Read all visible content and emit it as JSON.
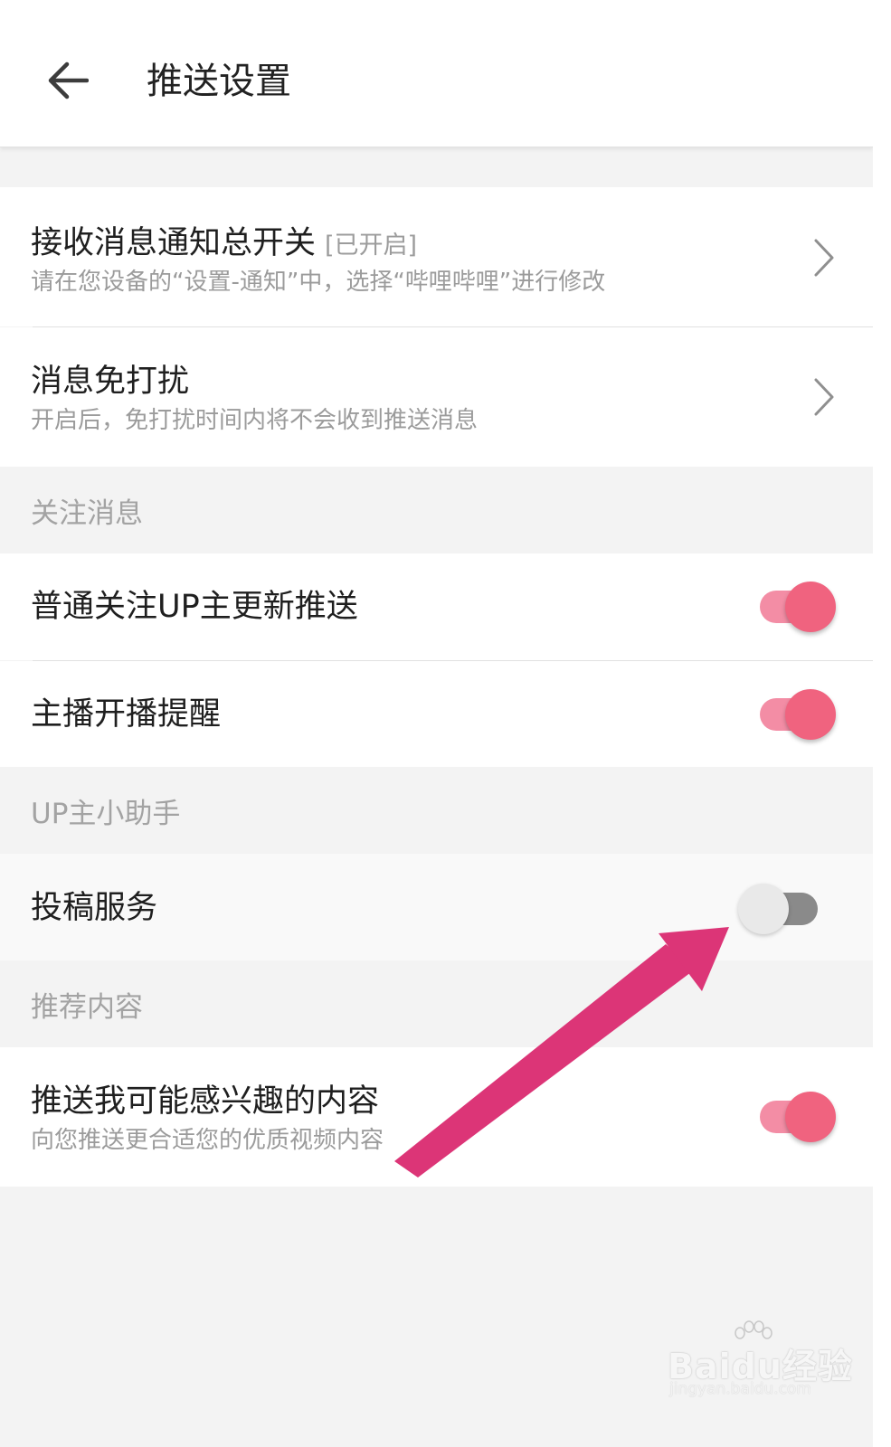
{
  "header": {
    "title": "推送设置",
    "back_icon": "arrow-left-icon"
  },
  "rows": {
    "notify_master": {
      "title": "接收消息通知总开关",
      "tag": "[已开启]",
      "subtitle": "请在您设备的“设置-通知”中，选择“哔哩哔哩”进行修改"
    },
    "dnd": {
      "title": "消息免打扰",
      "subtitle": "开启后，免打扰时间内将不会收到推送消息"
    },
    "follow_updates": {
      "title": "普通关注UP主更新推送",
      "toggle": true
    },
    "live_reminder": {
      "title": "主播开播提醒",
      "toggle": true
    },
    "submission_service": {
      "title": "投稿服务",
      "toggle": false
    },
    "interest_push": {
      "title": "推送我可能感兴趣的内容",
      "subtitle": "向您推送更合适您的优质视频内容",
      "toggle": true
    }
  },
  "sections": {
    "follow": "关注消息",
    "up_helper": "UP主小助手",
    "recommend": "推荐内容"
  },
  "colors": {
    "accent": "#f0637f",
    "accent_track": "#f38da5",
    "annotation_arrow": "#dc3577",
    "page_bg": "#f3f3f3"
  },
  "watermark": {
    "logo": "Baidu经验",
    "url": "jingyan.baidu.com"
  }
}
